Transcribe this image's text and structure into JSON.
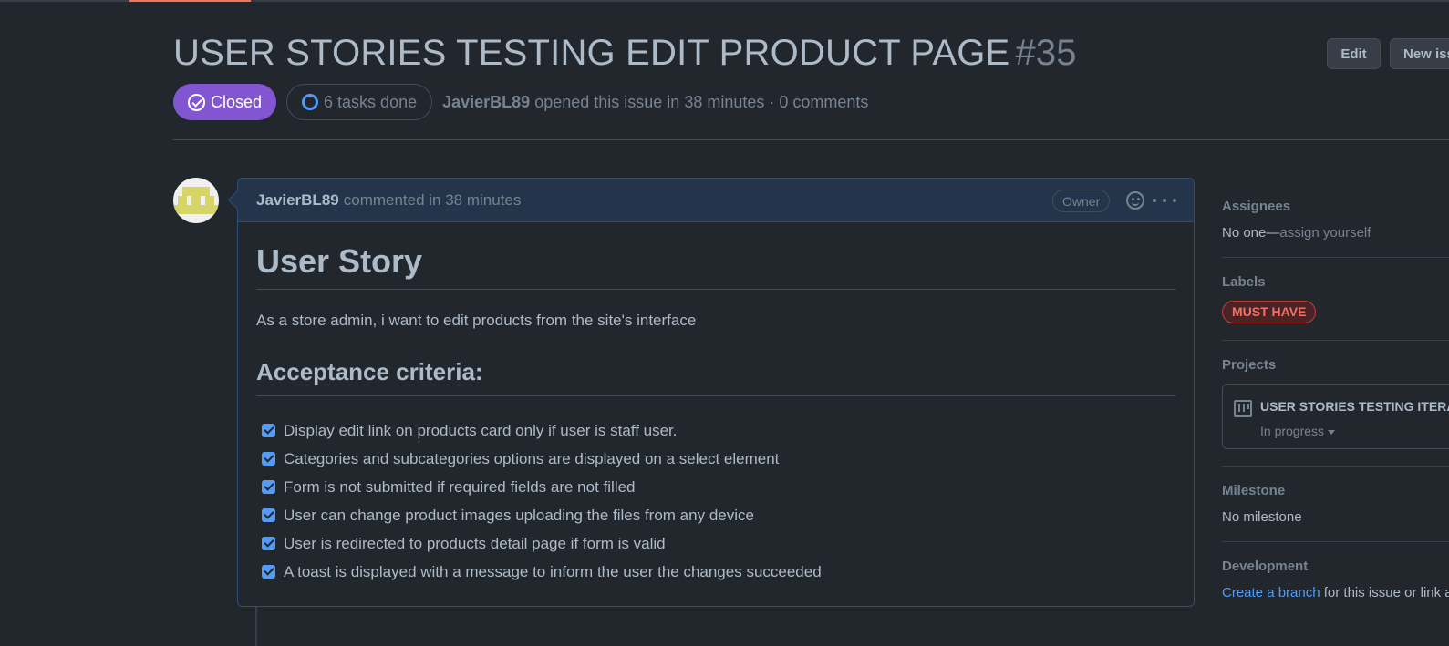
{
  "issue": {
    "title": "USER STORIES TESTING EDIT PRODUCT PAGE",
    "number": "#35",
    "state": "Closed",
    "tasks": "6 tasks done",
    "author": "JavierBL89",
    "meta_rest": "opened this issue in 38 minutes · 0 comments"
  },
  "header_buttons": {
    "edit": "Edit",
    "new_issue": "New iss"
  },
  "comment": {
    "author": "JavierBL89",
    "action": "commented in 38 minutes",
    "role_badge": "Owner",
    "heading": "User Story",
    "story": "As a store admin, i want to edit products from the site's interface",
    "criteria_heading": "Acceptance criteria:",
    "tasks": [
      {
        "label": "Display edit link on products card only if user is staff user.",
        "checked": true
      },
      {
        "label": "Categories and subcategories options are displayed on a select element",
        "checked": true
      },
      {
        "label": "Form is not submitted if required fields are not filled",
        "checked": true
      },
      {
        "label": "User can change product images uploading the files from any device",
        "checked": true
      },
      {
        "label": "User is redirected to products detail page if form is valid",
        "checked": true
      },
      {
        "label": "A toast is displayed with a message to inform the user the changes succeeded",
        "checked": true
      }
    ]
  },
  "sidebar": {
    "assignees": {
      "title": "Assignees",
      "value": "No one—",
      "action": "assign yourself"
    },
    "labels": {
      "title": "Labels",
      "items": [
        "MUST HAVE"
      ]
    },
    "projects": {
      "title": "Projects",
      "name": "USER STORIES TESTING ITERAT",
      "status": "In progress"
    },
    "milestone": {
      "title": "Milestone",
      "value": "No milestone"
    },
    "development": {
      "title": "Development",
      "link": "Create a branch",
      "rest": "for this issue or link a"
    }
  },
  "icons": [
    "check-circle-icon",
    "progress-ring-icon",
    "smiley-icon",
    "kebab-icon",
    "project-board-icon",
    "caret-down-icon"
  ],
  "colors": {
    "closed": "#8256d0",
    "accent": "#539bf5",
    "label_red": "#f47067",
    "bg": "#22272e"
  }
}
